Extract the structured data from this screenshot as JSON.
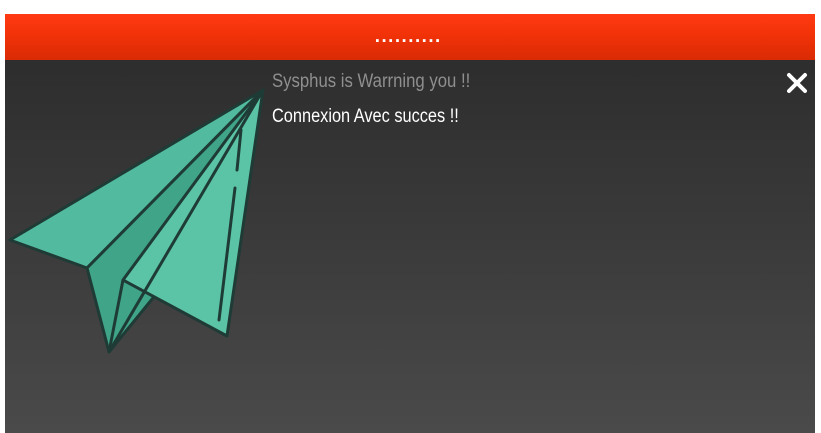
{
  "window": {
    "title": "..........",
    "accent_color": "#f23208"
  },
  "notification": {
    "heading": "Sysphus is Warrning you !!",
    "message": "Connexion Avec succes !!"
  },
  "icons": {
    "main": "paper-plane-icon",
    "close": "close-icon"
  }
}
